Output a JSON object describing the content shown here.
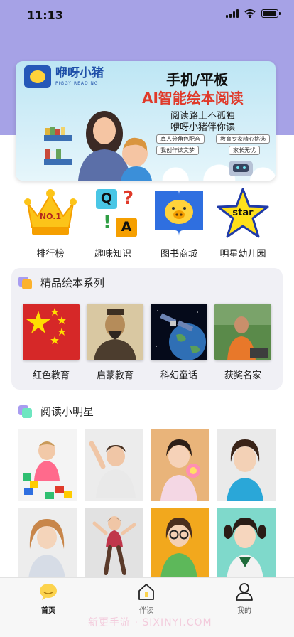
{
  "status_bar": {
    "time": "11:13"
  },
  "banner": {
    "logo_text": "咿呀小猪",
    "logo_subtext": "PIGGY READING",
    "title_line1": "手机/平板",
    "title_line2": "AI智能绘本阅读",
    "subtitle_line1": "阅读路上不孤独",
    "subtitle_line2": "咿呀小猪伴你读",
    "tags": [
      "真人分角色配音",
      "教育专家精心挑选",
      "我创作读文梦",
      "家长无忧"
    ]
  },
  "categories": [
    {
      "label": "排行榜",
      "icon": "crown-icon",
      "badge_text": "NO.1"
    },
    {
      "label": "趣味知识",
      "icon": "quiz-icon",
      "letters": [
        "Q",
        "?",
        "!",
        "A"
      ]
    },
    {
      "label": "图书商城",
      "icon": "book-store-icon"
    },
    {
      "label": "明星幼儿园",
      "icon": "star-icon",
      "badge_text": "star"
    }
  ],
  "series": {
    "title": "精品绘本系列",
    "items": [
      {
        "label": "红色教育",
        "thumb": "china-flag"
      },
      {
        "label": "启蒙教育",
        "thumb": "confucius-portrait"
      },
      {
        "label": "科幻童话",
        "thumb": "satellite-earth"
      },
      {
        "label": "获奖名家",
        "thumb": "author-photo"
      }
    ]
  },
  "stars": {
    "title": "阅读小明星",
    "photos": [
      "child-blocks",
      "child-smiling",
      "child-lollipop",
      "child-dress",
      "child-curly",
      "child-jumping",
      "child-glasses",
      "child-pigtails"
    ]
  },
  "tabbar": {
    "items": [
      {
        "label": "首页",
        "icon": "home-bubble-icon",
        "active": true
      },
      {
        "label": "伴读",
        "icon": "house-icon",
        "active": false
      },
      {
        "label": "我的",
        "icon": "person-icon",
        "active": false
      }
    ]
  },
  "watermark": "新更手游 · SIXINYI.COM",
  "colors": {
    "header_bg": "#a6a2e6",
    "accent_yellow": "#fcd34d",
    "series_card_bg": "#f0f0f5"
  }
}
